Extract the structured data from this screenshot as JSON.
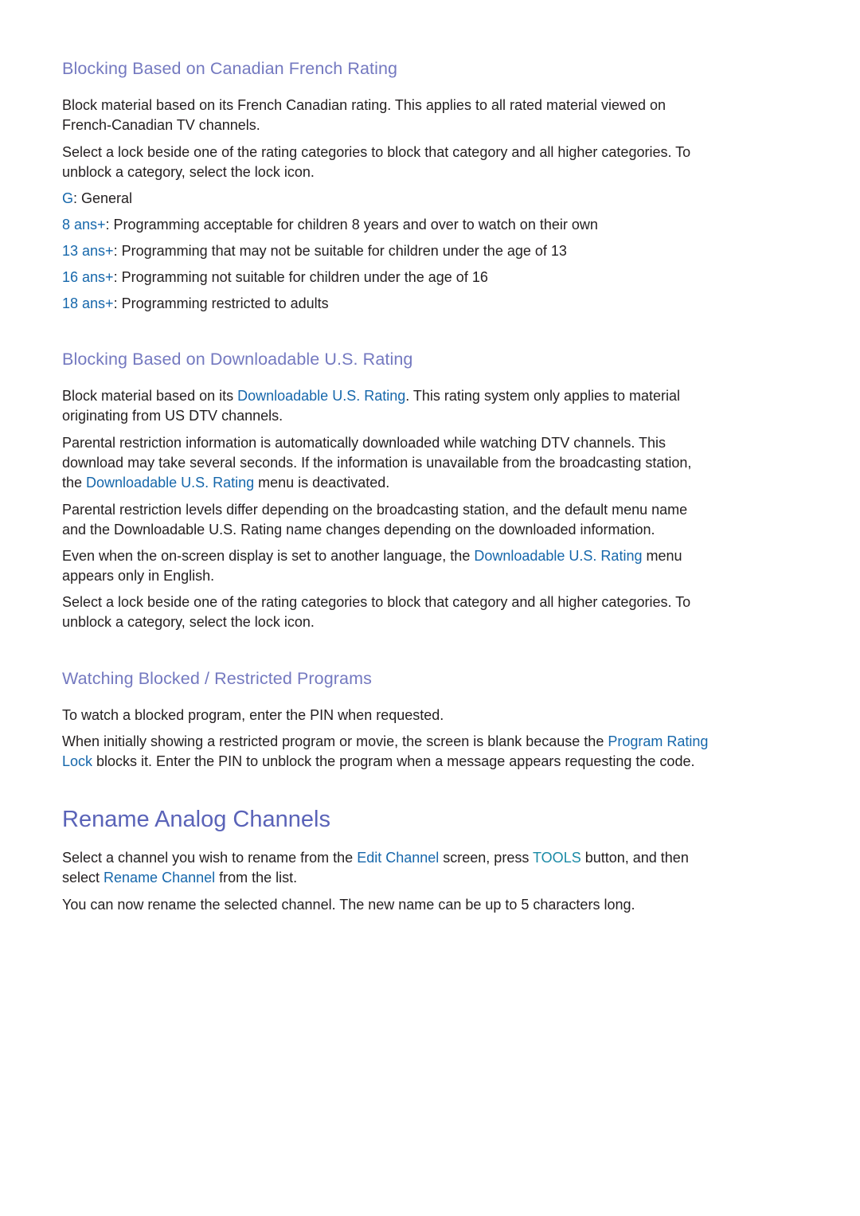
{
  "section_canadian_french": {
    "heading": "Blocking Based on Canadian French Rating",
    "para1_line1": "Block material based on its French Canadian rating. This applies to all rated material viewed on",
    "para1_line2": "French-Canadian TV channels.",
    "para2_line1": "Select a lock beside one of the rating categories to block that category and all higher categories. To",
    "para2_line2": "unblock a category, select the lock icon.",
    "ratings": [
      {
        "code": "G",
        "desc": ": General"
      },
      {
        "code": "8 ans+",
        "desc": ": Programming acceptable for children 8 years and over to watch on their own"
      },
      {
        "code": "13 ans+",
        "desc": ": Programming that may not be suitable for children under the age of 13"
      },
      {
        "code": "16 ans+",
        "desc": ": Programming not suitable for children under the age of 16"
      },
      {
        "code": "18 ans+",
        "desc": ": Programming restricted to adults"
      }
    ]
  },
  "section_downloadable_us": {
    "heading": "Blocking Based on Downloadable U.S. Rating",
    "p1_a": "Block material based on its ",
    "p1_link": "Downloadable U.S. Rating",
    "p1_b": ". This rating system only applies to material",
    "p1_line2": "originating from US DTV channels.",
    "p2_line1": "Parental restriction information is automatically downloaded while watching DTV channels. This",
    "p2_line2": "download may take several seconds. If the information is unavailable from the broadcasting station,",
    "p2_line3_a": "the ",
    "p2_line3_link": "Downloadable U.S. Rating",
    "p2_line3_b": " menu is deactivated.",
    "p3_line1": "Parental restriction levels differ depending on the broadcasting station, and the default menu name",
    "p3_line2": "and the Downloadable U.S. Rating name changes depending on the downloaded information.",
    "p4_a": "Even when the on-screen display is set to another language, the ",
    "p4_link": "Downloadable U.S. Rating",
    "p4_b": " menu",
    "p4_line2": "appears only in English.",
    "p5_line1": "Select a lock beside one of the rating categories to block that category and all higher categories. To",
    "p5_line2": "unblock a category, select the lock icon."
  },
  "section_watching_blocked": {
    "heading": "Watching Blocked / Restricted Programs",
    "p1": "To watch a blocked program, enter the PIN when requested.",
    "p2_a": "When initially showing a restricted program or movie, the screen is blank because the ",
    "p2_link_1": "Program Rating",
    "p2_link_2": "Lock",
    "p2_b": " blocks it. Enter the PIN to unblock the program when a message appears requesting the code."
  },
  "section_rename_analog": {
    "heading": "Rename Analog Channels",
    "p1_a": "Select a channel you wish to rename from the ",
    "p1_link_edit": "Edit Channel",
    "p1_b": " screen, press ",
    "p1_button": "TOOLS",
    "p1_c": " button, and then",
    "p1_line2_a": "select ",
    "p1_link_rename": "Rename Channel",
    "p1_line2_b": " from the list.",
    "p2": "You can now rename the selected channel. The new name can be up to 5 characters long."
  },
  "colors": {
    "heading": "#7479c0",
    "title": "#5a63b8",
    "link": "#1667ab",
    "button": "#1a8aa6",
    "body_text": "#231f20"
  }
}
